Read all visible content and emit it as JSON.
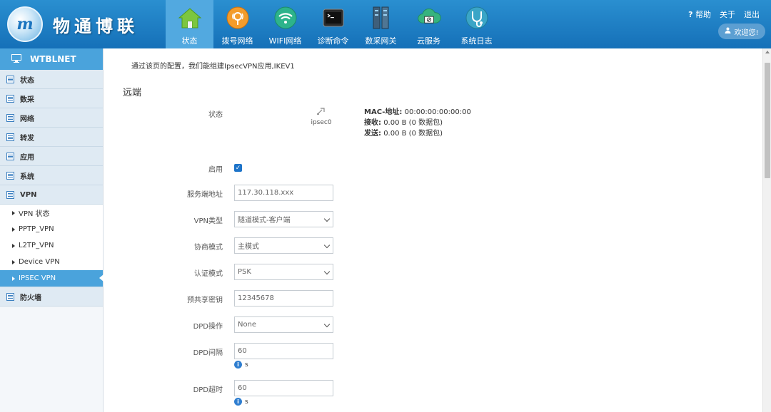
{
  "brand": {
    "logo_mark": "m",
    "name": "物通博联"
  },
  "nav": [
    {
      "label": "状态",
      "icon": "home-icon",
      "active": true
    },
    {
      "label": "拨号网络",
      "icon": "dial-network-icon"
    },
    {
      "label": "WIFI网络",
      "icon": "wifi-icon"
    },
    {
      "label": "诊断命令",
      "icon": "terminal-icon"
    },
    {
      "label": "数采网关",
      "icon": "gateway-icon"
    },
    {
      "label": "云服务",
      "icon": "cloud-icon"
    },
    {
      "label": "系统日志",
      "icon": "stethoscope-icon"
    }
  ],
  "toplinks": {
    "help": "帮助",
    "about": "关于",
    "logout": "退出",
    "welcome": "欢迎您!"
  },
  "sidebar": {
    "title": "WTBLNET",
    "items": [
      {
        "label": "状态"
      },
      {
        "label": "数采"
      },
      {
        "label": "网络"
      },
      {
        "label": "转发"
      },
      {
        "label": "应用"
      },
      {
        "label": "系统"
      },
      {
        "label": "VPN"
      }
    ],
    "vpn_sub": [
      {
        "label": "VPN 状态"
      },
      {
        "label": "PPTP_VPN"
      },
      {
        "label": "L2TP_VPN"
      },
      {
        "label": "Device VPN"
      },
      {
        "label": "IPSEC VPN",
        "active": true
      }
    ],
    "last": {
      "label": "防火墙"
    }
  },
  "main": {
    "description": "通过该页的配置，我们能组建IpsecVPN应用,IKEV1",
    "section_title": "远端",
    "status": {
      "label": "状态",
      "iface": "ipsec0",
      "mac_label": "MAC-地址:",
      "mac_value": "00:00:00:00:00:00",
      "rx_label": "接收:",
      "rx_value": "0.00 B (0 数据包)",
      "tx_label": "发送:",
      "tx_value": "0.00 B (0 数据包)"
    },
    "fields": {
      "enable_label": "启用",
      "enable_checked": true,
      "server_label": "服务端地址",
      "server_value": "117.30.118.xxx",
      "vpn_type_label": "VPN类型",
      "vpn_type_value": "隧道模式-客户端",
      "negotiation_label": "协商模式",
      "negotiation_value": "主模式",
      "auth_label": "认证模式",
      "auth_value": "PSK",
      "psk_label": "预共享密钥",
      "psk_value": "12345678",
      "dpd_action_label": "DPD操作",
      "dpd_action_value": "None",
      "dpd_interval_label": "DPD间隔",
      "dpd_interval_value": "60",
      "dpd_interval_unit": "s",
      "dpd_timeout_label": "DPD超时",
      "dpd_timeout_value": "60",
      "dpd_timeout_unit": "s"
    }
  },
  "colors": {
    "header": "#1a78c2",
    "accent": "#4aa3dc",
    "active_nav": "#52a9e0"
  }
}
